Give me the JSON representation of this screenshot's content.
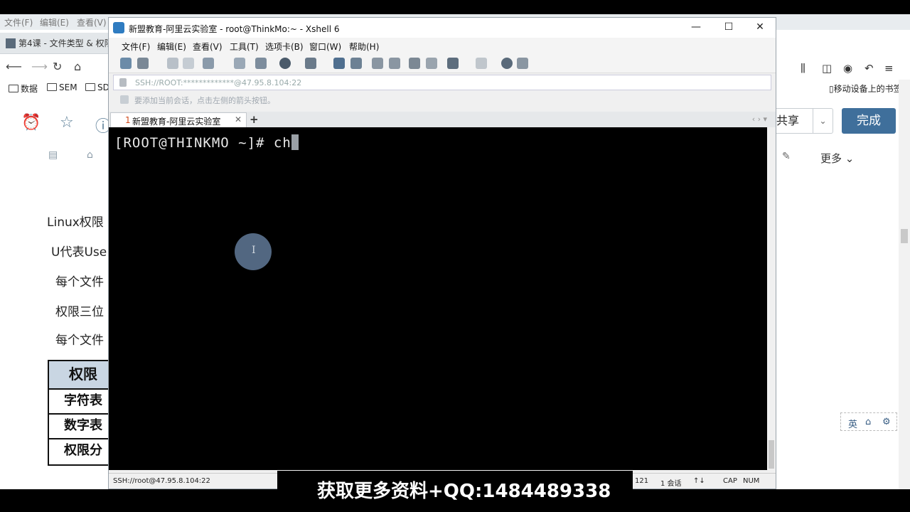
{
  "browser": {
    "menu": [
      "文件(F)",
      "编辑(E)",
      "查看(V)"
    ],
    "tab_title": "第4课 - 文件类型 & 权限",
    "bookmarks": [
      "数据",
      "SEM",
      "SD"
    ],
    "mobile_bookmarks": "移动设备上的书签",
    "share_label": "共享",
    "done_label": "完成",
    "more_label": "更多",
    "ime": [
      "英",
      "⌂",
      "⚙"
    ]
  },
  "document": {
    "lines": [
      "Linux权限",
      "U代表Use",
      "每个文件",
      "权限三位",
      "每个文件"
    ],
    "table_rows": [
      "权限",
      "字符表",
      "数字表",
      "权限分"
    ]
  },
  "xshell": {
    "title": "新盟教育-阿里云实验室 - root@ThinkMo:~ - Xshell 6",
    "menu": [
      "文件(F)",
      "编辑(E)",
      "查看(V)",
      "工具(T)",
      "选项卡(B)",
      "窗口(W)",
      "帮助(H)"
    ],
    "address": "SSH://ROOT:*************@47.95.8.104:22",
    "hint": "要添加当前会话，点击左侧的箭头按钮。",
    "tab": {
      "number": "1",
      "label": "新盟教育-阿里云实验室"
    },
    "terminal_prompt": "[ROOT@THINKMO ~]# ch",
    "status": {
      "connection": "SSH://root@47.95.8.104:22",
      "size": "121",
      "sessions": "1 会话",
      "caps": "CAP",
      "num": "NUM"
    }
  },
  "caption": "获取更多资料+QQ:1484489338",
  "colors": {
    "accent_done": "#3f6f9b",
    "terminal_bg": "#000000",
    "terminal_fg": "#e8e8e8"
  }
}
